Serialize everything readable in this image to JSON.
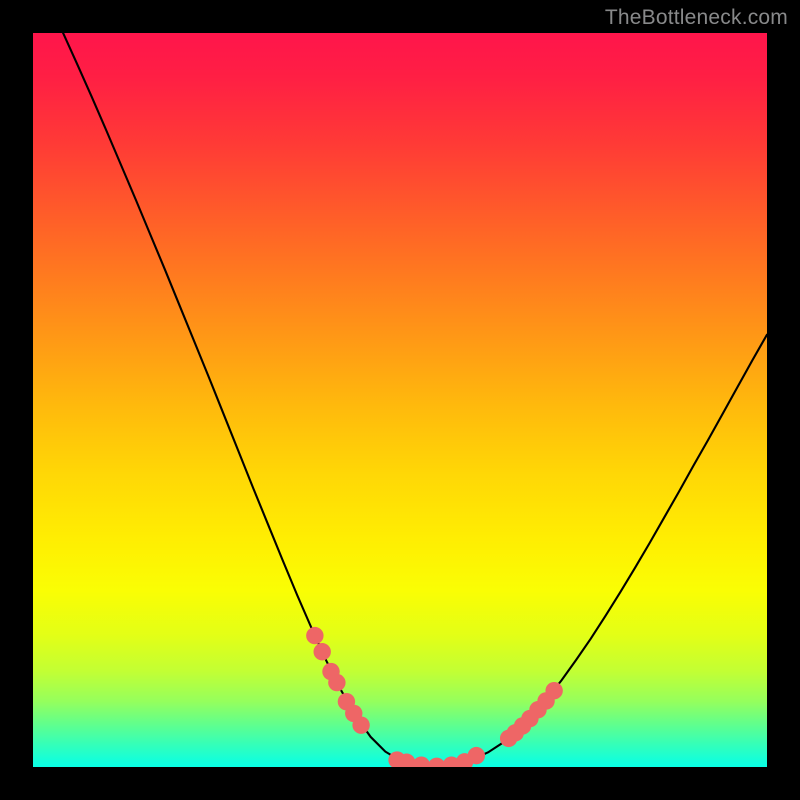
{
  "watermark": "TheBottleneck.com",
  "colors": {
    "background": "#000000",
    "gradient_top": "#ff154b",
    "gradient_bottom": "#0affe6",
    "curve_stroke": "#000000",
    "marker_fill": "#ee6666",
    "marker_stroke": "#ee6666"
  },
  "chart_data": {
    "type": "line",
    "title": "",
    "xlabel": "",
    "ylabel": "",
    "xlim": [
      0,
      100
    ],
    "ylim": [
      0,
      100
    ],
    "grid": false,
    "series": [
      {
        "name": "curve",
        "x": [
          4.1,
          6,
          8,
          10,
          12,
          14,
          16,
          18,
          20,
          22,
          24,
          26,
          28,
          30,
          32,
          34,
          36,
          38,
          40,
          42,
          44,
          46,
          48,
          50,
          52,
          54,
          56,
          58,
          60,
          62,
          64,
          66,
          68,
          70,
          72,
          74,
          76,
          78,
          80,
          82,
          84,
          86,
          88,
          90,
          92,
          94,
          96,
          98,
          100
        ],
        "y": [
          100,
          95.8,
          91.3,
          86.7,
          82,
          77.3,
          72.5,
          67.7,
          62.8,
          57.9,
          53,
          48,
          43,
          38,
          33.1,
          28.2,
          23.4,
          18.8,
          14.4,
          10.4,
          6.9,
          4.1,
          2.1,
          0.9,
          0.3,
          0.1,
          0.2,
          0.5,
          1.1,
          2,
          3.3,
          5,
          7,
          9.3,
          11.8,
          14.6,
          17.5,
          20.6,
          23.8,
          27.1,
          30.5,
          34,
          37.5,
          41.1,
          44.6,
          48.2,
          51.8,
          55.4,
          58.9
        ]
      }
    ],
    "markers": [
      {
        "name": "left-cluster",
        "x": [
          38.4,
          39.4,
          40.6,
          41.4,
          42.7,
          43.7,
          44.7
        ],
        "y": [
          17.9,
          15.7,
          13,
          11.5,
          8.9,
          7.3,
          5.7
        ]
      },
      {
        "name": "bottom-cluster",
        "x": [
          49.6,
          50.9,
          52.9,
          55,
          57,
          58.8,
          60.4
        ],
        "y": [
          0.95,
          0.65,
          0.25,
          0.1,
          0.25,
          0.7,
          1.55
        ]
      },
      {
        "name": "right-cluster",
        "x": [
          64.8,
          65.7,
          66.7,
          67.7,
          68.8,
          69.9,
          71
        ],
        "y": [
          3.9,
          4.65,
          5.6,
          6.6,
          7.8,
          9,
          10.4
        ]
      }
    ]
  }
}
